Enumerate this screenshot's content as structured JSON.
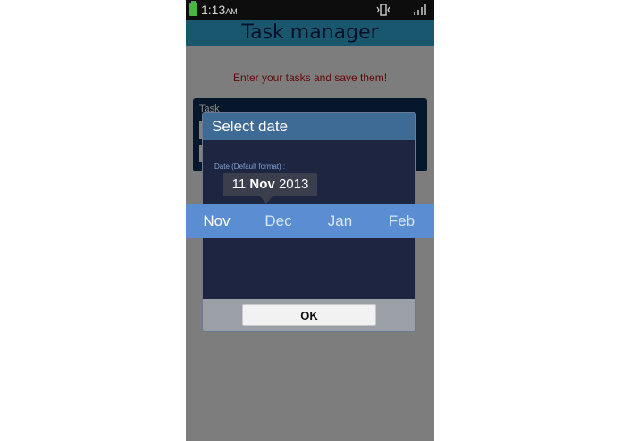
{
  "status_bar": {
    "time": "1:13",
    "ampm": "AM"
  },
  "app": {
    "title": "Task manager",
    "instruction": "Enter your tasks and save them!",
    "task_label": "Task"
  },
  "dialog": {
    "title": "Select date",
    "date_format_label": "Date (Default format) :",
    "date_day": "11",
    "date_month": "Nov",
    "date_year": "2013",
    "ok_label": "OK"
  },
  "month_picker": {
    "months": [
      "Nov",
      "Dec",
      "Jan",
      "Feb"
    ],
    "selected": "Nov"
  },
  "colors": {
    "title_bar": "#2ea4cf",
    "dialog_header": "#3e6a96",
    "month_strip": "#5b8dd2",
    "instruction_text": "#b80f0f",
    "battery": "#47b53f"
  },
  "icons": {
    "battery": "battery-icon",
    "vibrate": "vibrate-icon",
    "signal": "signal-icon"
  }
}
